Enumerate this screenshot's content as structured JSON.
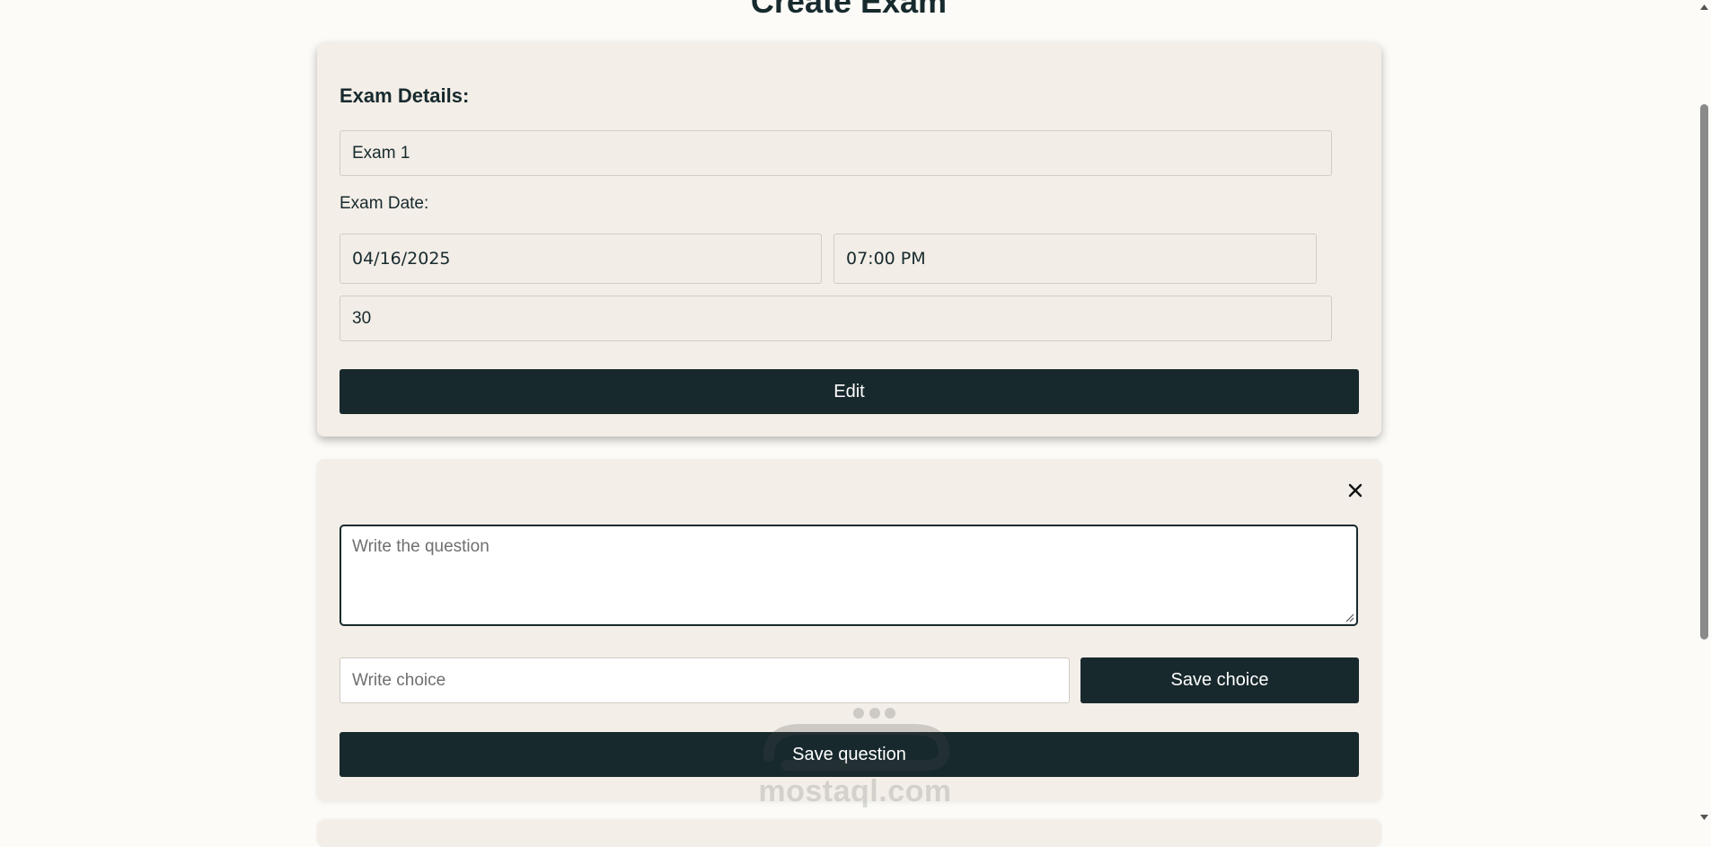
{
  "page": {
    "title": "Create Exam"
  },
  "exam_details": {
    "title": "Exam Details:",
    "name_value": "Exam 1",
    "date_label": "Exam Date:",
    "date_value": "04/16/2025",
    "time_value": "07:00 PM",
    "duration_value": "30",
    "edit_label": "Edit"
  },
  "question": {
    "close_icon": "close-icon",
    "question_placeholder": "Write the question",
    "choice_placeholder": "Write choice",
    "save_choice_label": "Save choice",
    "save_question_label": "Save question"
  },
  "watermark": {
    "text": "mostaql.com"
  },
  "colors": {
    "background": "#fcfbf7",
    "card": "#f3eee7",
    "primary_button": "#18292d",
    "text": "#172a2e"
  }
}
